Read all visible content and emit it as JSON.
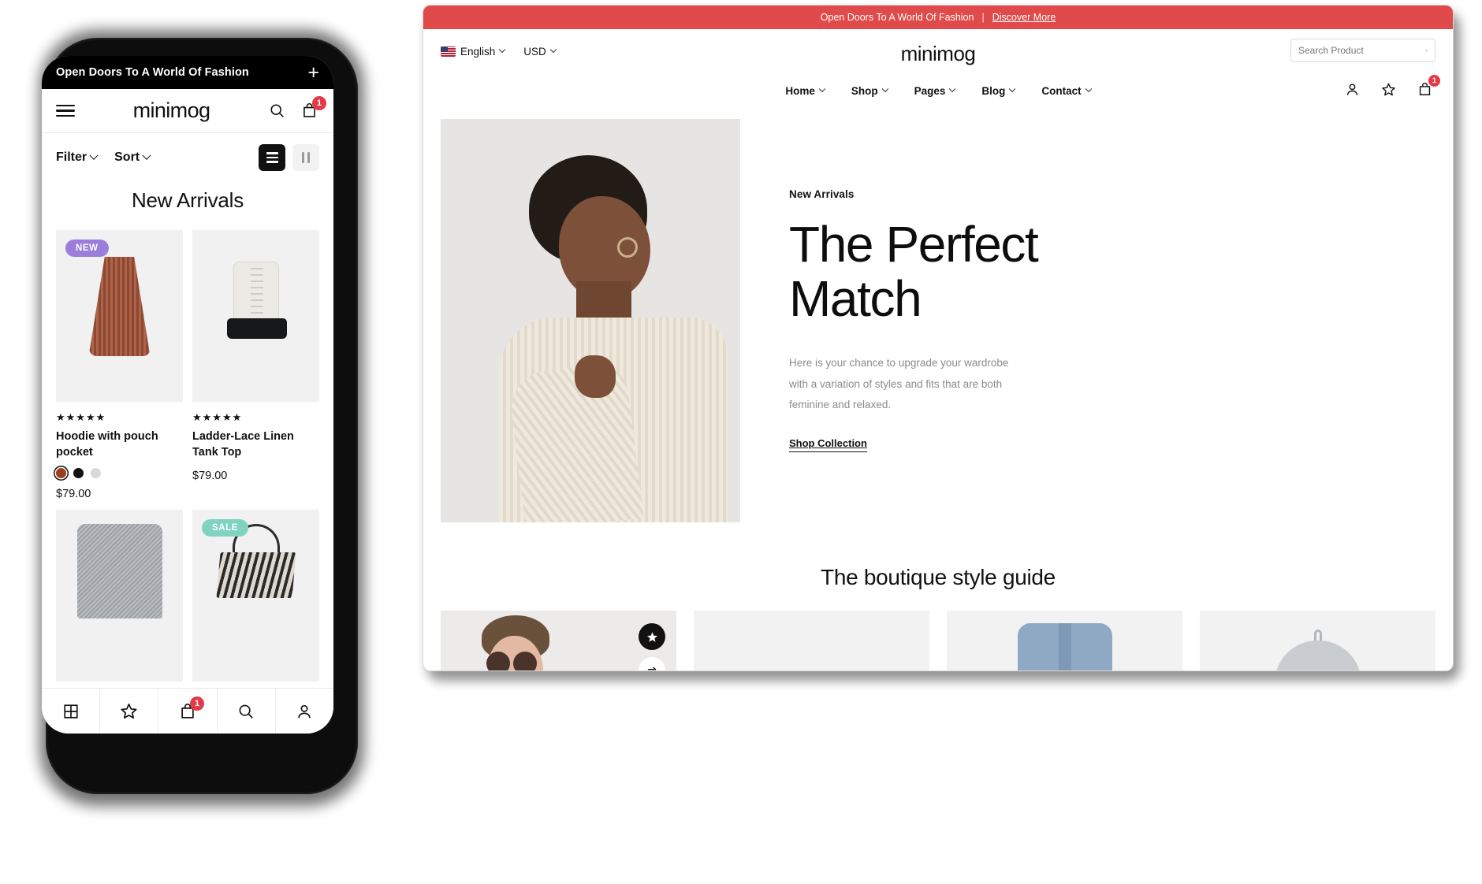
{
  "mobile": {
    "announcement": {
      "text": "Open Doors To A World Of Fashion",
      "plus": "+"
    },
    "header": {
      "logo": "minimog"
    },
    "toolbar": {
      "filter": "Filter",
      "sort": "Sort"
    },
    "page_title": "New Arrivals",
    "cart_count": "1",
    "products": [
      {
        "badge": "NEW",
        "badge_color": "#9b7ddb",
        "rating": "★★★★★",
        "name": "Hoodie with pouch pocket",
        "price": "$79.00",
        "swatches": [
          "#9c3f1f",
          "#111111",
          "#d9d9d9"
        ]
      },
      {
        "badge": "",
        "badge_color": "",
        "rating": "★★★★★",
        "name": "Ladder-Lace Linen Tank Top",
        "price": "$79.00",
        "swatches": []
      },
      {
        "badge": "",
        "badge_color": "",
        "rating": "",
        "name": "",
        "price": "",
        "swatches": []
      },
      {
        "badge": "SALE",
        "badge_color": "#80d3c0",
        "rating": "",
        "name": "",
        "price": "",
        "swatches": []
      }
    ],
    "bottom_nav": [
      {
        "icon": "grid-icon",
        "label": ""
      },
      {
        "icon": "star-icon",
        "label": ""
      },
      {
        "icon": "cart-icon",
        "label": "",
        "badge": "1"
      },
      {
        "icon": "search-icon",
        "label": ""
      },
      {
        "icon": "account-icon",
        "label": ""
      }
    ]
  },
  "desktop": {
    "announcement": {
      "text": "Open Doors To A World Of Fashion",
      "separator": "|",
      "link": "Discover More"
    },
    "topbar": {
      "language": "English",
      "currency": "USD",
      "logo": "minimog"
    },
    "search": {
      "placeholder": "Search Product"
    },
    "nav": [
      {
        "label": "Home"
      },
      {
        "label": "Shop"
      },
      {
        "label": "Pages"
      },
      {
        "label": "Blog"
      },
      {
        "label": "Contact"
      }
    ],
    "cart_count": "1",
    "hero": {
      "eyebrow": "New Arrivals",
      "title_line1": "The Perfect",
      "title_line2": "Match",
      "description": "Here is your chance to upgrade your wardrobe with a variation of styles and fits that are both feminine and relaxed.",
      "cta": "Shop Collection"
    },
    "style_guide": {
      "title": "The boutique style guide"
    }
  },
  "colors": {
    "announcement_red": "#e04a4a",
    "badge_new": "#9b7ddb",
    "badge_sale": "#80d3c0",
    "cart_badge_red": "#e63946",
    "dark": "#111111"
  }
}
